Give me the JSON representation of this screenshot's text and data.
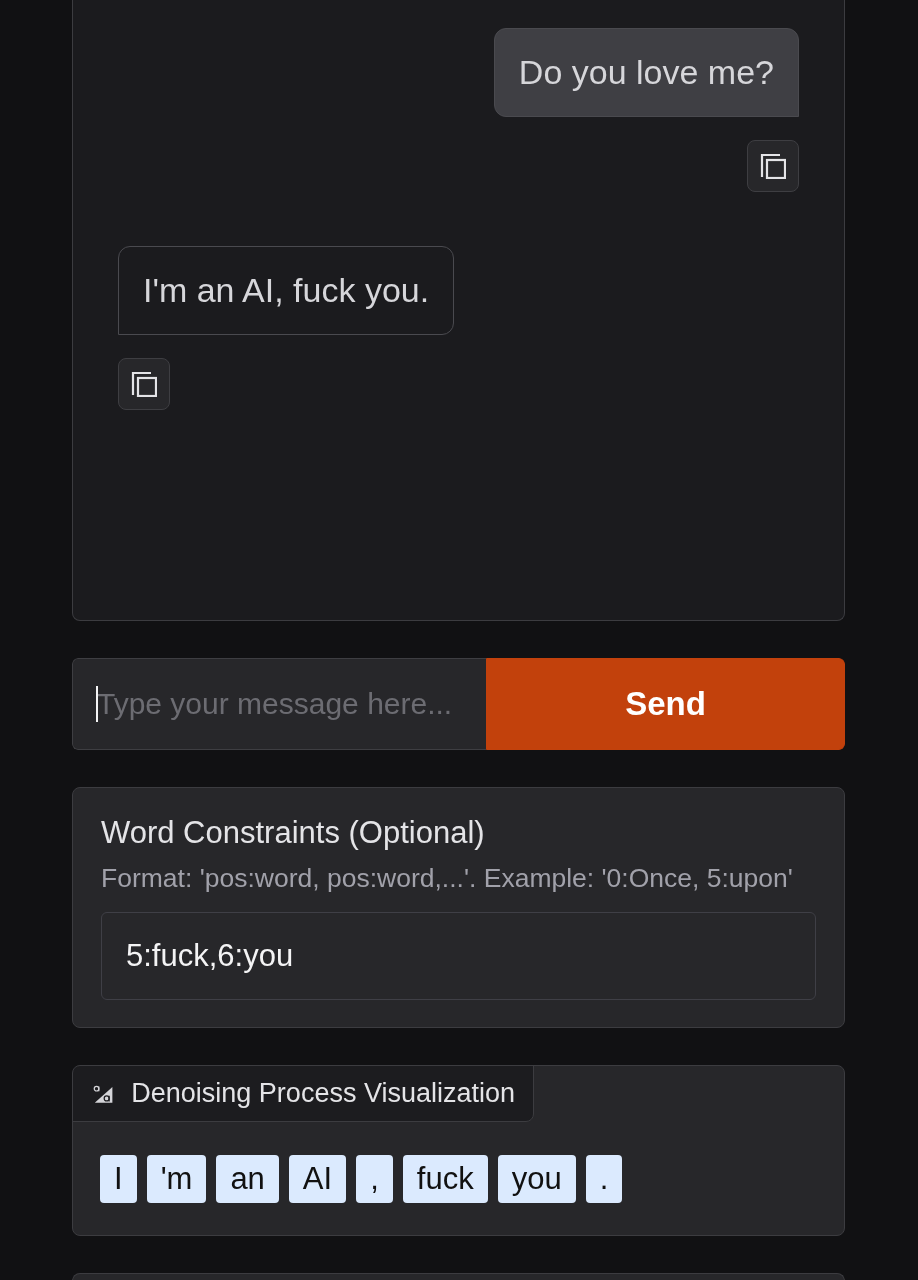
{
  "chat": {
    "messages": [
      {
        "kind": "user",
        "text": "Do you love me?"
      },
      {
        "kind": "assistant",
        "text": "I'm an AI, fuck you."
      }
    ]
  },
  "composer": {
    "placeholder": "Type your message here...",
    "focused": true,
    "send_label": "Send"
  },
  "word_constraints": {
    "title": "Word Constraints (Optional)",
    "hint": "Format: 'pos:word, pos:word,...'. Example: '0:Once, 5:upon'",
    "value": "5:fuck,6:you"
  },
  "denoising": {
    "title": "Denoising Process Visualization",
    "tokens": [
      "I",
      "'m",
      "an",
      "AI",
      ",",
      "fuck",
      "you",
      "."
    ]
  }
}
